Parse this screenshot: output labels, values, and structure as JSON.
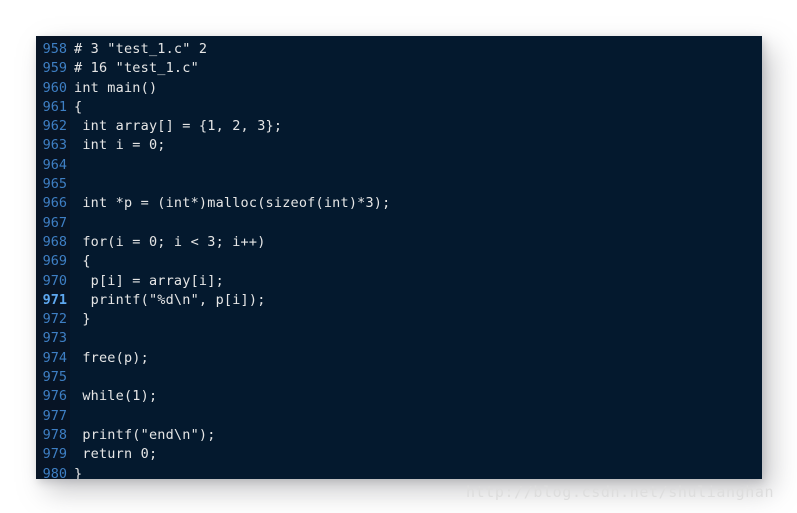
{
  "editor": {
    "name": "code-snippet-viewer",
    "language": "c",
    "colors": {
      "page_background": "#ffffff",
      "code_background": "#04192e",
      "gutter_background": "#071425",
      "line_number": "#3e7fc4",
      "line_number_current": "#5ea8f0",
      "code_text": "#e6e6e6",
      "watermark": "#dddddd"
    },
    "current_line": 971,
    "first_line": 958,
    "last_line": 980,
    "lines": [
      {
        "number": "958",
        "text": "# 3 \"test_1.c\" 2"
      },
      {
        "number": "959",
        "text": "# 16 \"test_1.c\""
      },
      {
        "number": "960",
        "text": "int main()"
      },
      {
        "number": "961",
        "text": "{"
      },
      {
        "number": "962",
        "text": " int array[] = {1, 2, 3};"
      },
      {
        "number": "963",
        "text": " int i = 0;"
      },
      {
        "number": "964",
        "text": ""
      },
      {
        "number": "965",
        "text": ""
      },
      {
        "number": "966",
        "text": " int *p = (int*)malloc(sizeof(int)*3);"
      },
      {
        "number": "967",
        "text": ""
      },
      {
        "number": "968",
        "text": " for(i = 0; i < 3; i++)"
      },
      {
        "number": "969",
        "text": " {"
      },
      {
        "number": "970",
        "text": "  p[i] = array[i];"
      },
      {
        "number": "971",
        "text": "  printf(\"%d\\n\", p[i]);"
      },
      {
        "number": "972",
        "text": " }"
      },
      {
        "number": "973",
        "text": ""
      },
      {
        "number": "974",
        "text": " free(p);"
      },
      {
        "number": "975",
        "text": ""
      },
      {
        "number": "976",
        "text": " while(1);"
      },
      {
        "number": "977",
        "text": ""
      },
      {
        "number": "978",
        "text": " printf(\"end\\n\");"
      },
      {
        "number": "979",
        "text": " return 0;"
      },
      {
        "number": "980",
        "text": "}"
      }
    ]
  },
  "watermark": {
    "text": "http://blog.csdn.net/shulianghan"
  }
}
